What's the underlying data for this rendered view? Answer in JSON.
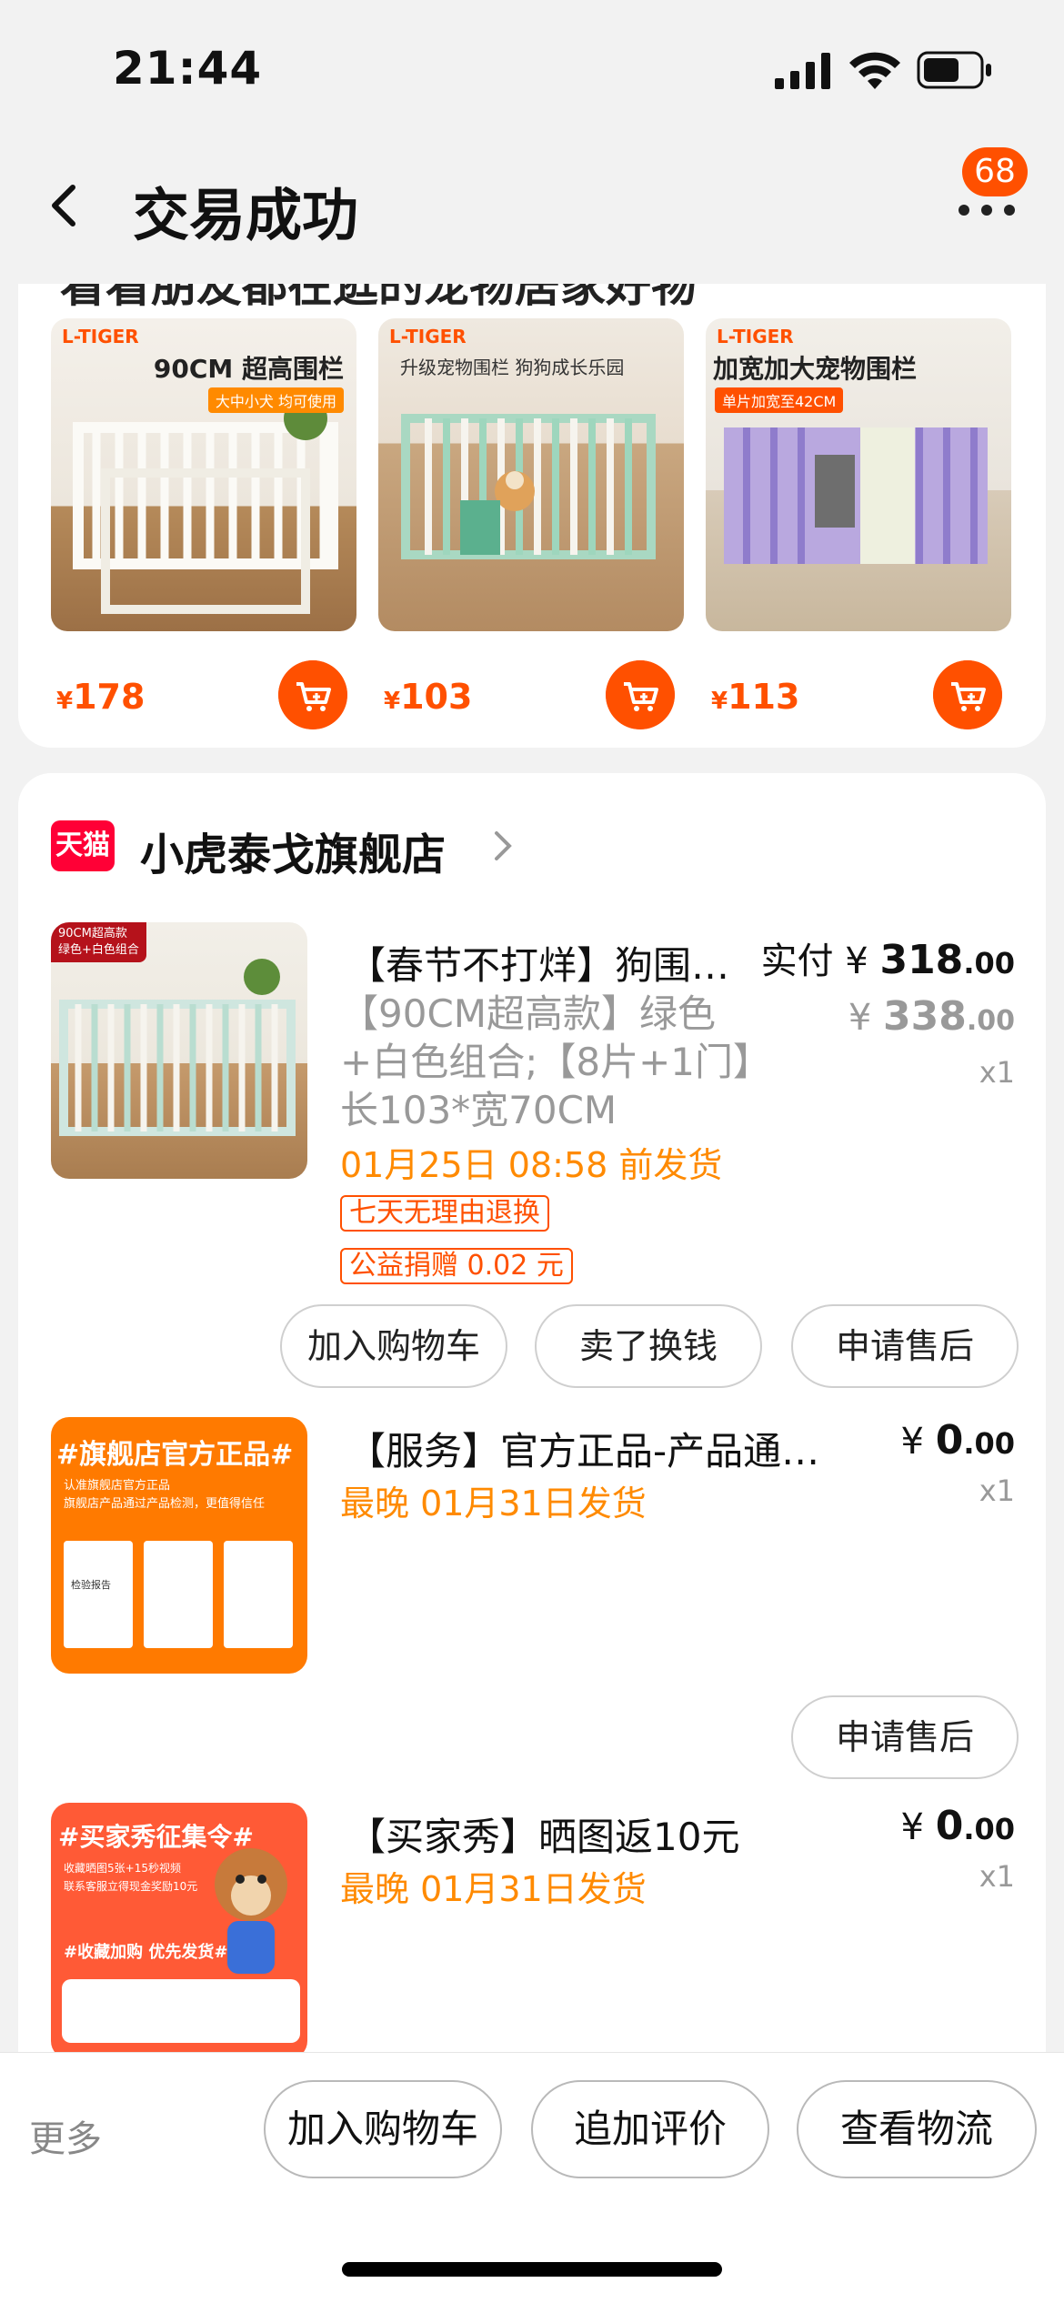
{
  "status": {
    "time": "21:44"
  },
  "nav": {
    "title": "交易成功",
    "badge_count": "68"
  },
  "recommend": {
    "title": "看看朋友都在逛的宠物居家好物",
    "items": [
      {
        "brand": "L-TIGER",
        "headline": "90CM 超高围栏",
        "subline": "大中小犬 均可使用",
        "price_symbol": "¥",
        "price": "178"
      },
      {
        "brand": "L-TIGER",
        "headline": "升级宠物围栏 狗狗成长乐园",
        "subline": "",
        "price_symbol": "¥",
        "price": "103"
      },
      {
        "brand": "L-TIGER",
        "headline": "加宽加大宠物围栏",
        "subline": "单片加宽至42CM",
        "price_symbol": "¥",
        "price": "113"
      }
    ]
  },
  "shop": {
    "logo_text": "天猫",
    "name": "小虎泰戈旗舰店",
    "items": [
      {
        "thumb_tag": "90CM超高款",
        "thumb_tag2": "绿色+白色组合",
        "title": "【春节不打烊】狗围栏宠物围栏",
        "sku": "【90CM超高款】绿色+白色组合;【8片+1门】长103*宽70CM",
        "ship": "01月25日 08:58 前发货",
        "tags": [
          "七天无理由退换",
          "公益捐赠 0.02 元"
        ],
        "paid_label": "实付",
        "price_symbol": "¥",
        "paid_int": "318",
        "paid_dec": ".00",
        "orig_int": "338",
        "orig_dec": ".00",
        "qty": "x1",
        "actions": [
          "加入购物车",
          "卖了换钱",
          "申请售后"
        ]
      },
      {
        "thumb_title": "#旗舰店官方正品#",
        "thumb_line1": "认准旗舰店官方正品",
        "thumb_line2": "旗舰店产品通过产品检测，更值得信任",
        "thumb_doc": "检验报告",
        "title": "【服务】官方正品-产品通过检测",
        "ship": "最晚 01月31日发货",
        "price_symbol": "¥",
        "price_int": "0",
        "price_dec": ".00",
        "qty": "x1",
        "actions": [
          "申请售后"
        ]
      },
      {
        "thumb_title": "#买家秀征集令#",
        "thumb_line1": "收藏晒图5张+15秒视频",
        "thumb_line2": "联系客服立得现金奖励10元",
        "thumb_line3": "#收藏加购 优先发货#",
        "title": "【买家秀】晒图返10元",
        "ship": "最晚 01月31日发货",
        "price_symbol": "¥",
        "price_int": "0",
        "price_dec": ".00",
        "qty": "x1"
      }
    ]
  },
  "bottom": {
    "more": "更多",
    "buttons": [
      "加入购物车",
      "追加评价",
      "查看物流"
    ]
  }
}
